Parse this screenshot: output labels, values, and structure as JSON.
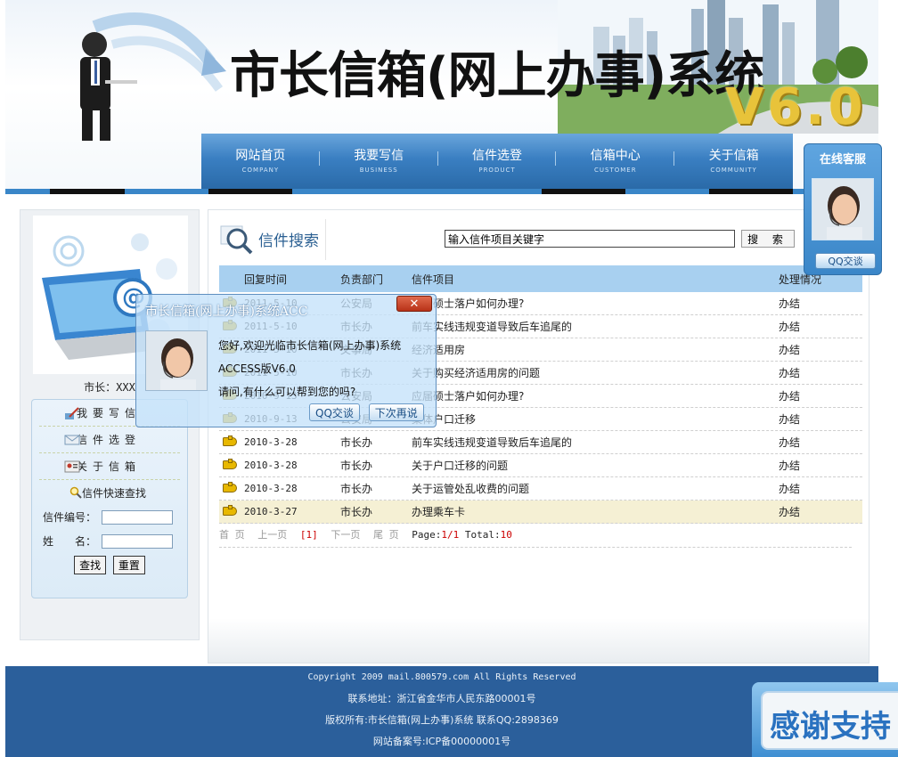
{
  "header": {
    "title": "市长信箱(网上办事)系统",
    "version": "V6.0"
  },
  "nav": [
    {
      "label": "网站首页",
      "sub": "COMPANY"
    },
    {
      "label": "我要写信",
      "sub": "BUSINESS"
    },
    {
      "label": "信件选登",
      "sub": "PRODUCT"
    },
    {
      "label": "信箱中心",
      "sub": "CUSTOMER"
    },
    {
      "label": "关于信箱",
      "sub": "COMMUNITY"
    }
  ],
  "sidebar": {
    "mayor_label": "市长：XXX",
    "menu": [
      {
        "label": "我要写信",
        "icon": "pen-icon"
      },
      {
        "label": "信件选登",
        "icon": "envelope-icon"
      },
      {
        "label": "关于信箱",
        "icon": "id-card-icon"
      }
    ],
    "quick_search_title": "信件快速查找",
    "letter_no_label": "信件编号：",
    "name_label": "姓　　名：",
    "find_btn": "查找",
    "reset_btn": "重置"
  },
  "search": {
    "title": "信件搜索",
    "placeholder": "输入信件项目关键字",
    "button": "搜 索"
  },
  "table": {
    "headers": [
      "回复时间",
      "负责部门",
      "信件项目",
      "处理情况"
    ],
    "rows": [
      {
        "date": "2011-5-10",
        "dept": "公安局",
        "item": "博士硕士落户如何办理?",
        "status": "办结"
      },
      {
        "date": "2011-5-10",
        "dept": "市长办",
        "item": "前车实线违规变道导致后车追尾的",
        "status": "办结"
      },
      {
        "date": "2011-5-10",
        "dept": "文事局",
        "item": "经济适用房",
        "status": "办结"
      },
      {
        "date": "2011-5-10",
        "dept": "市长办",
        "item": "关于购买经济适用房的问题",
        "status": "办结"
      },
      {
        "date": "2010-9-13",
        "dept": "公安局",
        "item": "应届硕士落户如何办理?",
        "status": "办结"
      },
      {
        "date": "2010-9-13",
        "dept": "公安局",
        "item": "集体户口迁移",
        "status": "办结"
      },
      {
        "date": "2010-3-28",
        "dept": "市长办",
        "item": "前车实线违规变道导致后车追尾的",
        "status": "办结"
      },
      {
        "date": "2010-3-28",
        "dept": "市长办",
        "item": "关于户口迁移的问题",
        "status": "办结"
      },
      {
        "date": "2010-3-28",
        "dept": "市长办",
        "item": "关于运管处乱收费的问题",
        "status": "办结"
      },
      {
        "date": "2010-3-27",
        "dept": "市长办",
        "item": "办理乘车卡",
        "status": "办结"
      }
    ],
    "highlighted_row": 9
  },
  "pager": {
    "first": "首 页",
    "prev": "上一页",
    "current": "[1]",
    "next": "下一页",
    "last": "尾 页",
    "page_label": "Page:",
    "page_value": "1/1",
    "total_label": "Total:",
    "total_value": "10"
  },
  "footer": {
    "copyright": "Copyright 2009 mail.800579.com All Rights Reserved",
    "address": "联系地址：浙江省金华市人民东路00001号",
    "owner": "版权所有:市长信箱(网上办事)系统 联系QQ:2898369",
    "icp": "网站备案号:ICP备00000001号"
  },
  "cs_widget": {
    "title": "在线客服",
    "button": "QQ交谈"
  },
  "dialog": {
    "title": "市长信箱(网上办事)系统ACC",
    "close": "✕",
    "line1": "您好,欢迎光临市长信箱(网上办事)系统",
    "line2": "ACCESS版V6.0",
    "line3": "请问,有什么可以帮到您的吗?",
    "btn_chat": "QQ交谈",
    "btn_later": "下次再说"
  },
  "thanks_badge": "感谢支持",
  "colors": {
    "nav_blue": "#3a7fc2",
    "footer_blue": "#2b5f9b",
    "table_header": "#a8d0f0",
    "version_gold": "#e8c33a",
    "page_red": "#cc0000"
  }
}
